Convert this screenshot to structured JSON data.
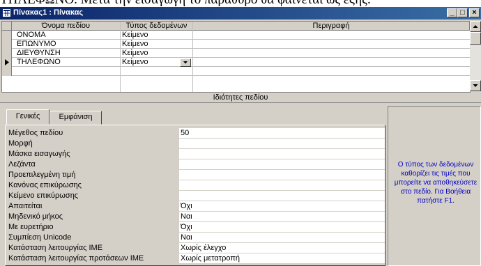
{
  "top_text": "ΤΗΛΕΦΩΝΟ. Μετά την εισαγωγή το παράθυρο θα φαίνεται ως εξής:",
  "window": {
    "title": "Πίνακας1 : Πίνακας",
    "minimize": "_",
    "maximize": "□",
    "close": "×"
  },
  "grid": {
    "columns": [
      "Όνομα πεδίου",
      "Τύπος δεδομένων",
      "Περιγραφή"
    ],
    "rows": [
      {
        "name": "ΟΝΟΜΑ",
        "type": "Κείμενο",
        "description": ""
      },
      {
        "name": "ΕΠΩΝΥΜΟ",
        "type": "Κείμενο",
        "description": ""
      },
      {
        "name": "ΔΙΕΥΘΥΝΣΗ",
        "type": "Κείμενο",
        "description": ""
      },
      {
        "name": "ΤΗΛΕΦΩΝΟ",
        "type": "Κείμενο",
        "description": ""
      },
      {
        "name": "",
        "type": "",
        "description": ""
      }
    ],
    "current_row_index": 3
  },
  "properties": {
    "title": "Ιδιότητες πεδίου",
    "tabs": [
      "Γενικές",
      "Εμφάνιση"
    ],
    "active_tab": "Γενικές",
    "rows": [
      {
        "label": "Μέγεθος πεδίου",
        "value": "50"
      },
      {
        "label": "Μορφή",
        "value": ""
      },
      {
        "label": "Μάσκα εισαγωγής",
        "value": ""
      },
      {
        "label": "Λεζάντα",
        "value": ""
      },
      {
        "label": "Προεπιλεγμένη τιμή",
        "value": ""
      },
      {
        "label": "Κανόνας επικύρωσης",
        "value": ""
      },
      {
        "label": "Κείμενο επικύρωσης",
        "value": ""
      },
      {
        "label": "Απαιτείται",
        "value": "Όχι"
      },
      {
        "label": "Μηδενικό μήκος",
        "value": "Ναι"
      },
      {
        "label": "Με ευρετήριο",
        "value": "Όχι"
      },
      {
        "label": "Συμπίεση Unicode",
        "value": "Ναι"
      },
      {
        "label": "Κατάσταση λειτουργίας IME",
        "value": "Χωρίς έλεγχο"
      },
      {
        "label": "Κατάσταση λειτουργίας προτάσεων IME",
        "value": "Χωρίς μετατροπή"
      }
    ]
  },
  "help_text": "Ο τύπος των δεδομένων καθορίζει τις τιμές που μπορείτε να αποθηκεύσετε στο πεδίο. Για Βοήθεια πατήστε F1.",
  "colors": {
    "title_start": "#0a246a",
    "title_end": "#3a6ea5",
    "help_text": "#0000c0",
    "face": "#d4d0c8"
  },
  "icons": {
    "title": "table-icon",
    "row_pointer": "row-pointer-icon",
    "dropdown": "dropdown-arrow-icon"
  }
}
